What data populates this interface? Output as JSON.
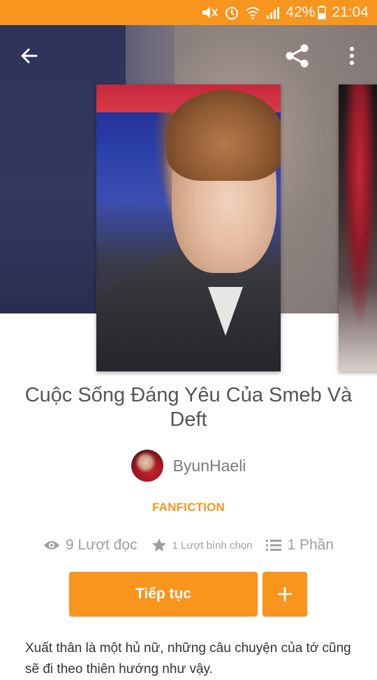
{
  "status_bar": {
    "battery": "42%",
    "time": "21:04",
    "icons": [
      "mute-icon",
      "alarm-icon",
      "wifi-icon",
      "signal-icon",
      "battery-icon"
    ]
  },
  "toolbar": {
    "icons": [
      "back-arrow-icon",
      "share-icon",
      "more-vert-icon"
    ]
  },
  "story": {
    "title": "Cuộc Sống Đáng Yêu Của Smeb Và Deft",
    "author": "ByunHaeli",
    "category": "FANFICTION",
    "reads": "9 Lượt đọc",
    "votes": "1 Lượt bình chọn",
    "parts": "1 Phần",
    "description": "Xuất thân là một hủ nữ, những câu chuyện của tớ cũng sẽ đi theo thiên hướng như vậy."
  },
  "actions": {
    "continue_label": "Tiếp tục",
    "add_label": "+"
  },
  "colors": {
    "accent": "#f7951d",
    "title_text": "#555555",
    "meta_text": "#9e9e9e"
  }
}
